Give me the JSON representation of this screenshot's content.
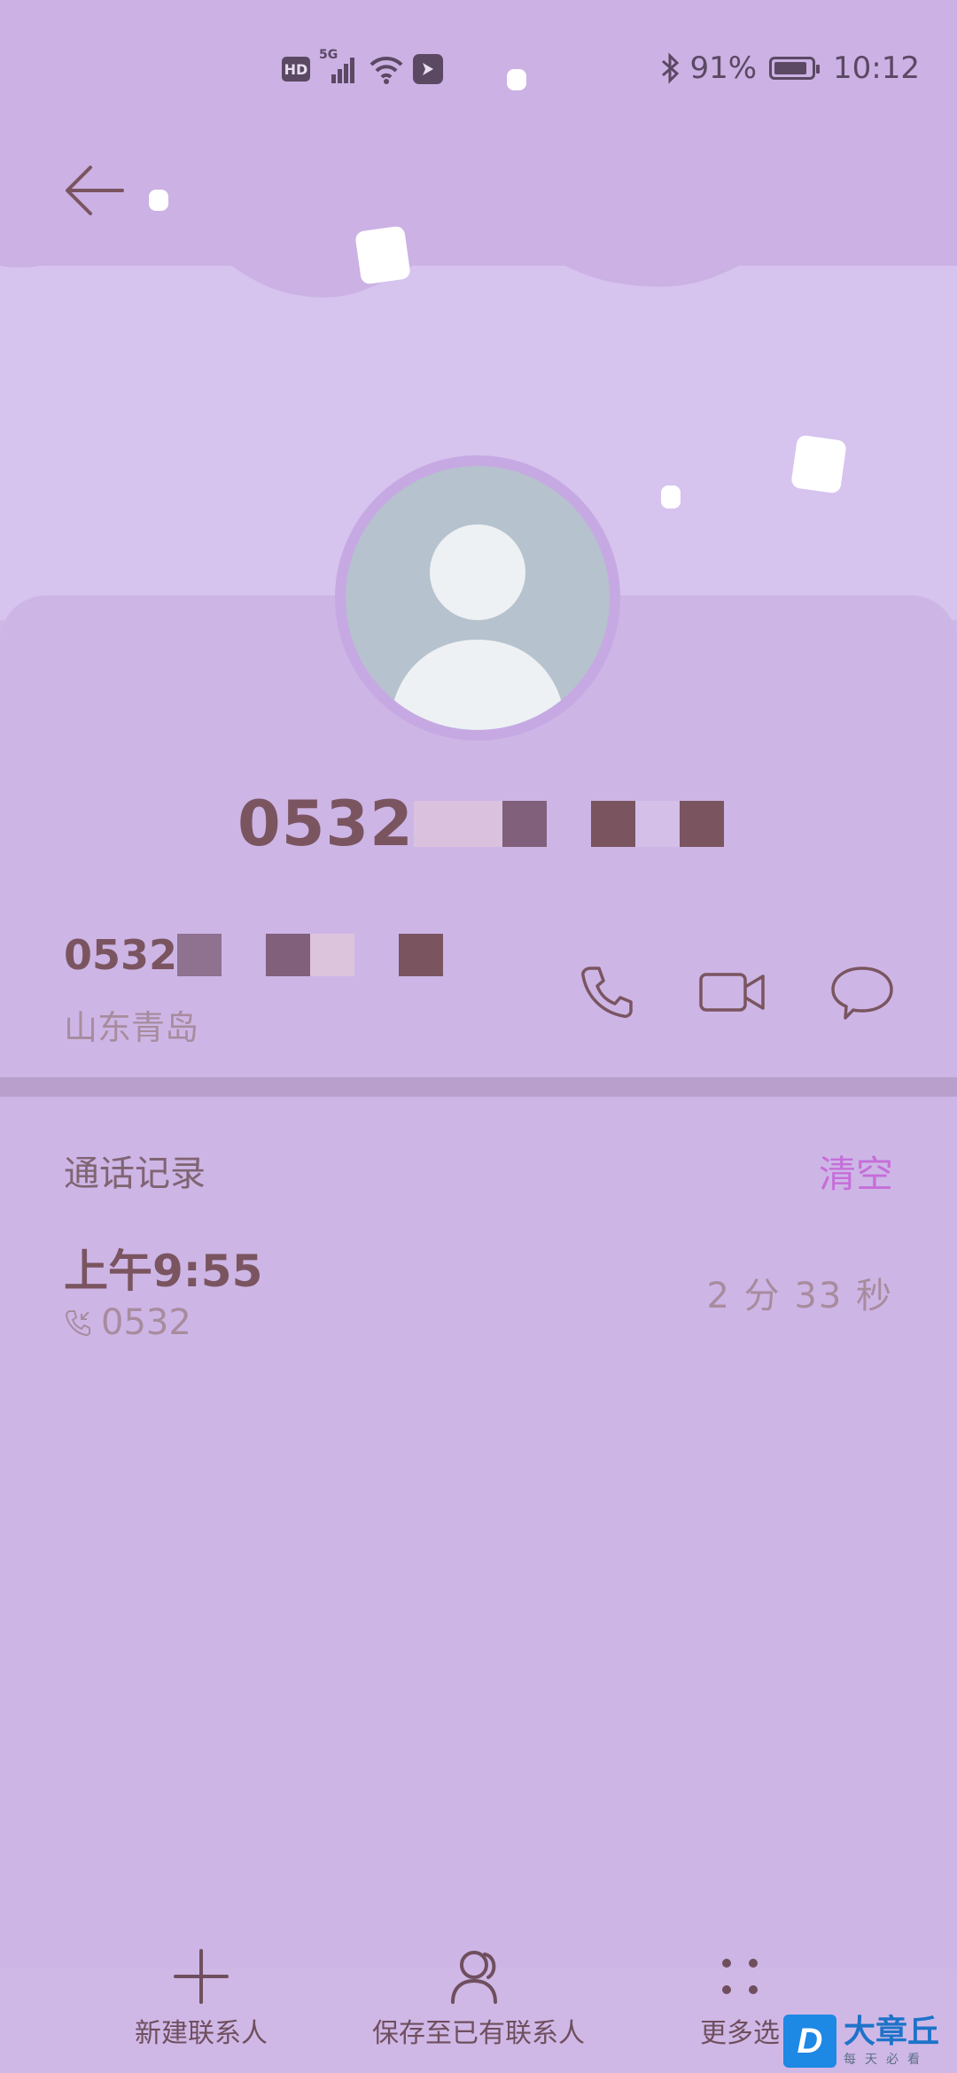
{
  "status_bar": {
    "hd": "HD",
    "network": "5G",
    "battery_percent": "91%",
    "battery_level": 0.91,
    "time": "10:12"
  },
  "contact": {
    "name_visible": "0532",
    "number_visible": "0532",
    "location": "山东青岛"
  },
  "call_log": {
    "title": "通话记录",
    "clear_label": "清空",
    "entries": [
      {
        "time": "上午9:55",
        "number": "0532",
        "duration": "2 分 33 秒"
      }
    ]
  },
  "bottom_bar": {
    "new_contact": "新建联系人",
    "save_existing": "保存至已有联系人",
    "more": "更多选"
  },
  "watermark": {
    "logo_letter": "D",
    "main": "大章丘",
    "sub": "每天必看"
  },
  "colors": {
    "background": "#cfb8e6",
    "text_primary": "#7a5560",
    "text_secondary": "#a88c9e",
    "accent": "#c66ed9"
  },
  "icons": {
    "back": "arrow-left-icon",
    "call": "phone-icon",
    "video": "video-camera-icon",
    "message": "chat-bubble-icon",
    "add": "plus-icon",
    "save": "person-icon",
    "more": "dots-grid-icon",
    "bluetooth": "bluetooth-icon",
    "wifi": "wifi-icon",
    "signal": "signal-icon"
  }
}
